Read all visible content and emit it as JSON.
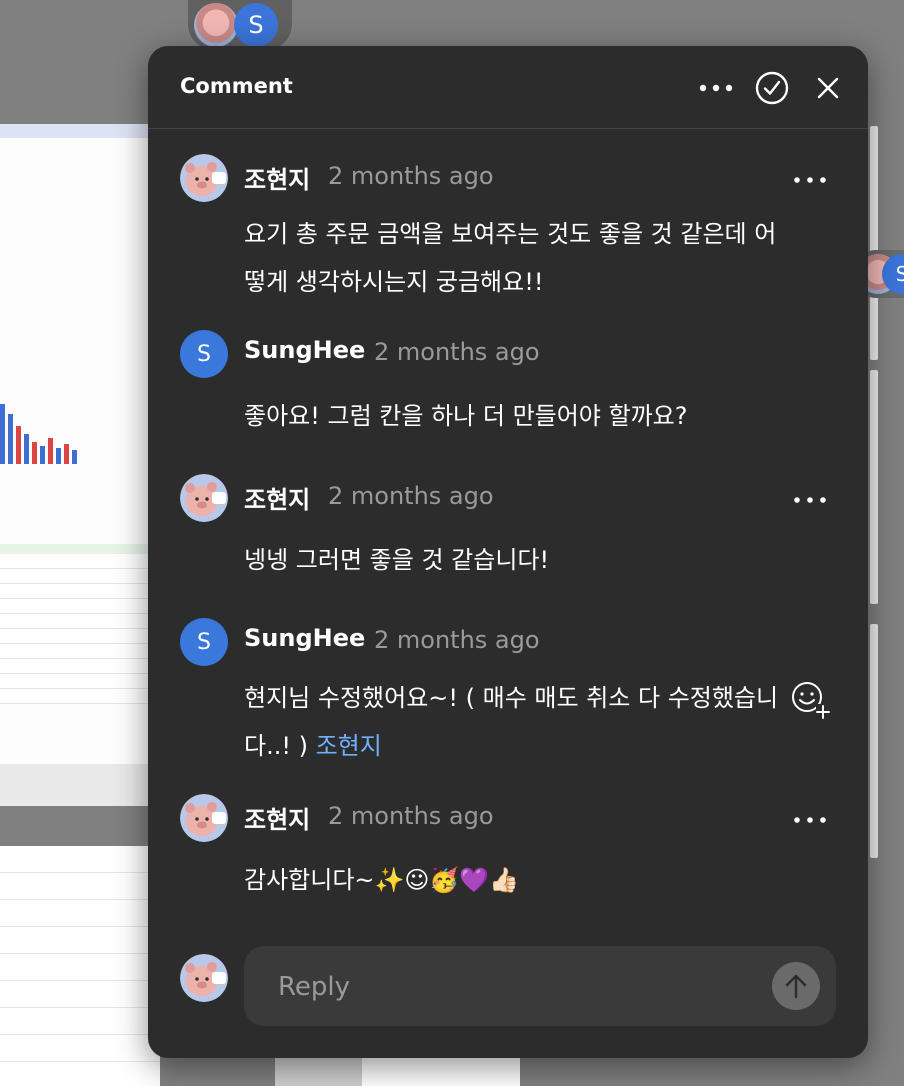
{
  "panel": {
    "title": "Comment",
    "more_icon": "more-horizontal-icon",
    "resolve_icon": "check-circle-icon",
    "close_icon": "close-icon"
  },
  "avatars": {
    "user_initial": "S",
    "user_color": "#3a78dc"
  },
  "comments": [
    {
      "author": "조현지",
      "time": "2 months ago",
      "avatar": "pink-character-avatar",
      "lines": [
        "요기 총 주문 금액을 보여주는 것도 좋을 것 같은데 어",
        "떻게 생각하시는지 궁금해요!!"
      ]
    },
    {
      "author": "SungHee",
      "time": "2 months ago",
      "avatar": "initial-avatar",
      "lines": [
        "좋아요! 그럼 칸을 하나 더 만들어야 할까요?"
      ]
    },
    {
      "author": "조현지",
      "time": "2 months ago",
      "avatar": "pink-character-avatar",
      "lines": [
        "넹넹 그러면 좋을 것 같습니다!"
      ]
    },
    {
      "author": "SungHee",
      "time": "2 months ago",
      "avatar": "initial-avatar",
      "lines": [
        "현지님 수정했어요~! ( 매수 매도 취소 다 수정했습니",
        "다..! ) "
      ],
      "mention": "조현지"
    },
    {
      "author": "조현지",
      "time": "2 months ago",
      "avatar": "pink-character-avatar",
      "text": "감사합니다~",
      "emojis": "✨☺🥳💜👍🏻"
    }
  ],
  "reply": {
    "placeholder": "Reply",
    "send_icon": "arrow-up-icon"
  },
  "colors": {
    "panel_bg": "#2c2c2c",
    "muted_text": "#9a9a9a",
    "mention": "#6fb0ff",
    "reply_bg": "#3a3a3a"
  }
}
